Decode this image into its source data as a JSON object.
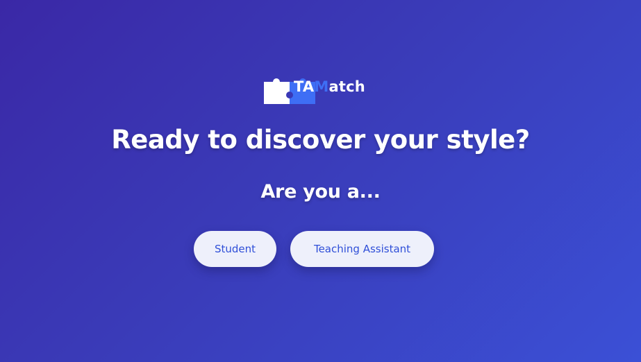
{
  "brand": {
    "logo_icon": "puzzle-piece-icon",
    "name_part_ta": "TA",
    "name_part_m": "M",
    "name_part_rest": "atch",
    "colors": {
      "puzzle_white": "#ffffff",
      "puzzle_blue": "#3e6ef5",
      "m_letter": "#3e6ef5"
    }
  },
  "main": {
    "headline": "Ready to discover your style?",
    "question": "Are you a...",
    "options": [
      {
        "label": "Student"
      },
      {
        "label": "Teaching Assistant"
      }
    ]
  },
  "theme": {
    "background_gradient": [
      "#3a28a6",
      "#3b50d6"
    ],
    "button_bg": "#eef0fb",
    "button_text": "#2f4fd8"
  }
}
